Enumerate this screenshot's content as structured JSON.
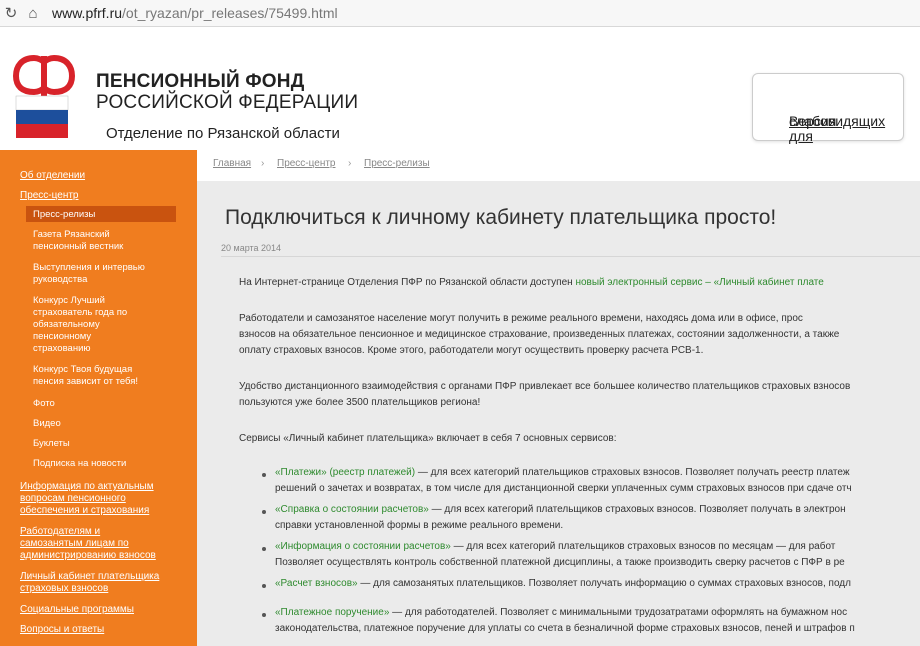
{
  "browser": {
    "url_host": "www.pfrf.ru",
    "url_path": "/ot_ryazan/pr_releases/75499.html"
  },
  "header": {
    "org_line1": "ПЕНСИОННЫЙ ФОНД",
    "org_line2": "РОССИЙСКОЙ ФЕДЕРАЦИИ",
    "branch": "Отделение по Рязанской области",
    "vision_link_line1": "Версия для",
    "vision_link_line2": "слабовидящих"
  },
  "sidebar": {
    "items": [
      {
        "label": "Об отделении"
      },
      {
        "label": "Пресс-центр"
      }
    ],
    "active_sub": "Пресс-релизы",
    "subitems": [
      {
        "label": "Газета Рязанский"
      },
      {
        "label": "пенсионный вестник"
      },
      {
        "label": "Выступления и интервью"
      },
      {
        "label": "руководства"
      },
      {
        "label": "Конкурс Лучший"
      },
      {
        "label": "страхователь года по"
      },
      {
        "label": "обязательному"
      },
      {
        "label": "пенсионному"
      },
      {
        "label": "страхованию"
      },
      {
        "label": "Конкурс Твоя будущая"
      },
      {
        "label": "пенсия зависит от тебя!"
      },
      {
        "label": "Фото"
      },
      {
        "label": "Видео"
      },
      {
        "label": "Буклеты"
      },
      {
        "label": "Подписка на новости"
      }
    ],
    "bottom_items": [
      {
        "label": "Информация по актуальным"
      },
      {
        "label": "вопросам пенсионного"
      },
      {
        "label": "обеспечения и страхования"
      },
      {
        "label": "Работодателям и"
      },
      {
        "label": "самозанятым лицам по"
      },
      {
        "label": "администрированию взносов"
      },
      {
        "label": "Личный кабинет плательщика"
      },
      {
        "label": "страховых взносов"
      },
      {
        "label": "Социальные программы"
      },
      {
        "label": "Вопросы и ответы"
      }
    ]
  },
  "breadcrumb": {
    "items": [
      "Главная",
      "Пресс-центр",
      "Пресс-релизы"
    ]
  },
  "article": {
    "title": "Подключиться к личному кабинету плательщика просто!",
    "date": "20 марта 2014",
    "p1_a": "На Интернет-странице Отделения ПФР по Рязанской области доступен ",
    "p1_b": "новый электронный сервис – «Личный кабинет плате",
    "p2_l1": "Работодатели и самозанятое население могут получить в режиме реального времени, находясь дома или в офисе, прос",
    "p2_l2": "взносов на обязательное пенсионное и медицинское страхование, произведенных платежах, состоянии задолженности, а также",
    "p2_l3": "оплату страховых взносов. Кроме этого, работодатели могут осуществить проверку расчета РСВ-1.",
    "p3_l1": "Удобство дистанционного взаимодействия с органами ПФР привлекает все большее количество плательщиков страховых взносов",
    "p3_l2": "пользуются уже более 3500 плательщиков региона!",
    "p4": "Сервисы «Личный кабинет плательщика» включает в себя 7 основных сервисов:",
    "li1_g": "«Платежи» (реестр платежей)",
    "li1_l1": " — для всех категорий плательщиков страховых взносов. Позволяет получать реестр платеж",
    "li1_l2": "решений о зачетах и возвратах, в том числе для дистанционной сверки уплаченных сумм страховых взносов при сдаче отч",
    "li2_g": "«Справка о состоянии расчетов»",
    "li2_l1": " — для всех категорий плательщиков страховых взносов. Позволяет получать в электрон",
    "li2_l2": "справки установленной формы в режиме реального времени.",
    "li3_g": "«Информация о состоянии расчетов»",
    "li3_l1": " — для всех категорий плательщиков страховых взносов по месяцам — для работ",
    "li3_l2": "Позволяет осуществлять контроль собственной платежной дисциплины, а также производить сверку расчетов с ПФР в ре",
    "li4_g": "«Расчет взносов»",
    "li4_l1": " — для самозанятых плательщиков. Позволяет получать информацию о суммах страховых взносов, подл",
    "li5_g": "«Платежное поручение»",
    "li5_l1": " — для работодателей. Позволяет с минимальными трудозатратами оформлять на бумажном нос",
    "li5_l2": "законодательства, платежное поручение для уплаты со счета в безналичной форме страховых взносов, пеней и штрафов п"
  },
  "colors": {
    "sidebar_bg": "#f07d1f",
    "sidebar_active": "#c9530f",
    "article_bg": "#ebebeb",
    "service_link": "#2e8a2e",
    "logo_red": "#d8232a",
    "logo_blue": "#1d4f9c"
  },
  "icons": {
    "reload": "reload-icon",
    "home": "home-icon",
    "logo": "pfr-logo-icon"
  }
}
